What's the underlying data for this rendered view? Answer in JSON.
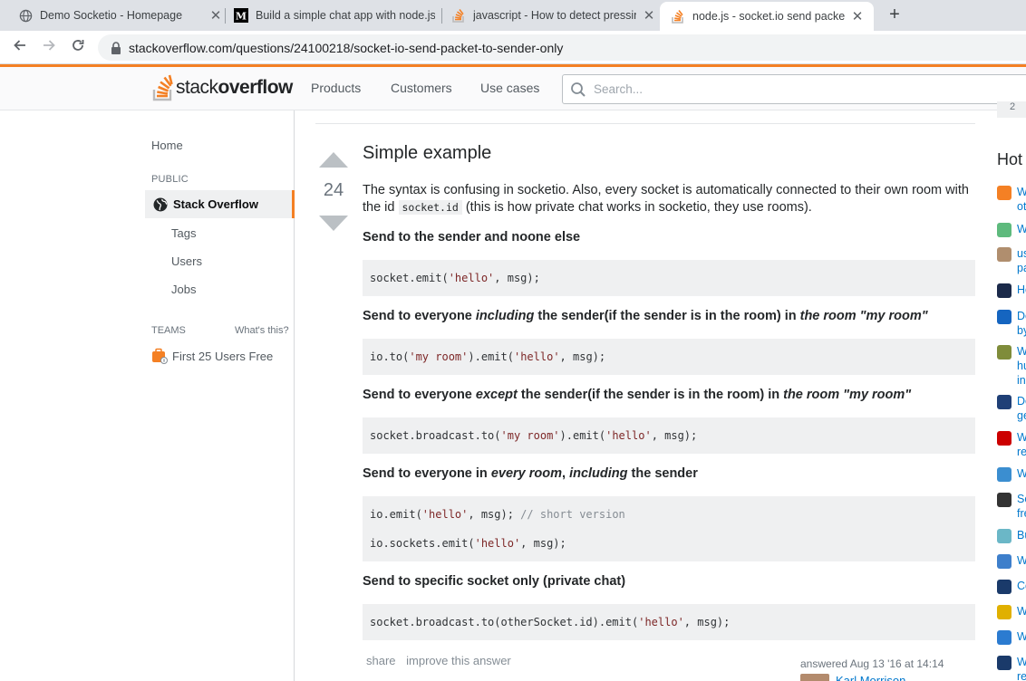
{
  "browser": {
    "tabs": [
      {
        "title": "Demo Socketio - Homepage",
        "icon": "globe-icon"
      },
      {
        "title": "Build a simple chat app with node.js",
        "icon": "medium-icon"
      },
      {
        "title": "javascript - How to detect pressing",
        "icon": "stackoverflow-icon"
      },
      {
        "title": "node.js - socket.io send packet to sender only",
        "icon": "stackoverflow-icon"
      }
    ],
    "new_tab": "+",
    "close_glyph": "✕",
    "url": "stackoverflow.com/questions/24100218/socket-io-send-packet-to-sender-only"
  },
  "header": {
    "logo_light": "stack",
    "logo_bold": "overflow",
    "nav": [
      "Products",
      "Customers",
      "Use cases"
    ],
    "search_placeholder": "Search..."
  },
  "leftnav": {
    "home": "Home",
    "public_label": "PUBLIC",
    "stack_overflow": "Stack Overflow",
    "tags": "Tags",
    "users": "Users",
    "jobs": "Jobs",
    "teams_label": "TEAMS",
    "whats_this": "What's this?",
    "first_users": "First 25 Users Free"
  },
  "answer": {
    "votes": "24",
    "heading": "Simple example",
    "intro_1": "The syntax is confusing in socketio. Also, every socket is automatically connected to their own room with the id ",
    "intro_code": "socket.id",
    "intro_2": " (this is how private chat works in socketio, they use rooms).",
    "s1_title": "Send to the sender and noone else",
    "s1_code": {
      "a": "socket.emit(",
      "s1": "'hello'",
      "b": ", msg);"
    },
    "s2_title_a": "Send to everyone ",
    "s2_title_i": "including",
    "s2_title_b": " the sender(if the sender is in the room) in ",
    "s2_title_i2": "the room \"my room\"",
    "s2_code": {
      "a": "io.to(",
      "s1": "'my room'",
      "b": ").emit(",
      "s2": "'hello'",
      "c": ", msg);"
    },
    "s3_title_a": "Send to everyone ",
    "s3_title_i": "except",
    "s3_title_b": " the sender(if the sender is in the room) in ",
    "s3_title_i2": "the room \"my room\"",
    "s3_code": {
      "a": "socket.broadcast.to(",
      "s1": "'my room'",
      "b": ").emit(",
      "s2": "'hello'",
      "c": ", msg);"
    },
    "s4_title_a": "Send to everyone in ",
    "s4_title_i": "every room",
    "s4_title_b": ", ",
    "s4_title_i2": "including",
    "s4_title_c": " the sender",
    "s4_code_1": {
      "a": "io.emit(",
      "s1": "'hello'",
      "b": ", msg); ",
      "cmt": "// short version"
    },
    "s4_code_2": {
      "a": "io.sockets.emit(",
      "s1": "'hello'",
      "b": ", msg);"
    },
    "s5_title": "Send to specific socket only (private chat)",
    "s5_code": {
      "a": "socket.broadcast.to(otherSocket.id).emit(",
      "s1": "'hello'",
      "b": ", msg);"
    },
    "share": "share",
    "improve": "improve this answer",
    "answered": "answered Aug 13 '16 at 14:14",
    "user": "Karl Morrison"
  },
  "rightbar": {
    "box_value": "2",
    "hot_title": "Hot",
    "items": [
      {
        "text": "Wh",
        "text2": "ot",
        "icon_color": "#f48024"
      },
      {
        "text": "Wh",
        "text2": "",
        "icon_color": "#5eba7d"
      },
      {
        "text": "us",
        "text2": "pa",
        "icon_color": "#b08e6e"
      },
      {
        "text": "Ho",
        "text2": "",
        "icon_color": "#1b2a4a"
      },
      {
        "text": "De",
        "text2": "by",
        "icon_color": "#1565c0"
      },
      {
        "text": "W",
        "text2": "hu",
        "text3": "in",
        "icon_color": "#7f8c3a"
      },
      {
        "text": "De",
        "text2": "ge",
        "icon_color": "#1f3f76"
      },
      {
        "text": "W",
        "text2": "re",
        "icon_color": "#cc0000"
      },
      {
        "text": "Wh",
        "text2": "",
        "icon_color": "#3b8ed0"
      },
      {
        "text": "Sc",
        "text2": "fre",
        "icon_color": "#333333"
      },
      {
        "text": "Bu",
        "text2": "",
        "icon_color": "#6bb7c7"
      },
      {
        "text": "Wh",
        "text2": "",
        "icon_color": "#3e7fcb"
      },
      {
        "text": "Co",
        "text2": "",
        "icon_color": "#1a3a6a"
      },
      {
        "text": "Wh",
        "text2": "",
        "icon_color": "#e0b000"
      },
      {
        "text": "W",
        "text2": "",
        "icon_color": "#2b7bd0"
      },
      {
        "text": "Wh",
        "text2": "re",
        "icon_color": "#1a3a6a"
      }
    ]
  }
}
